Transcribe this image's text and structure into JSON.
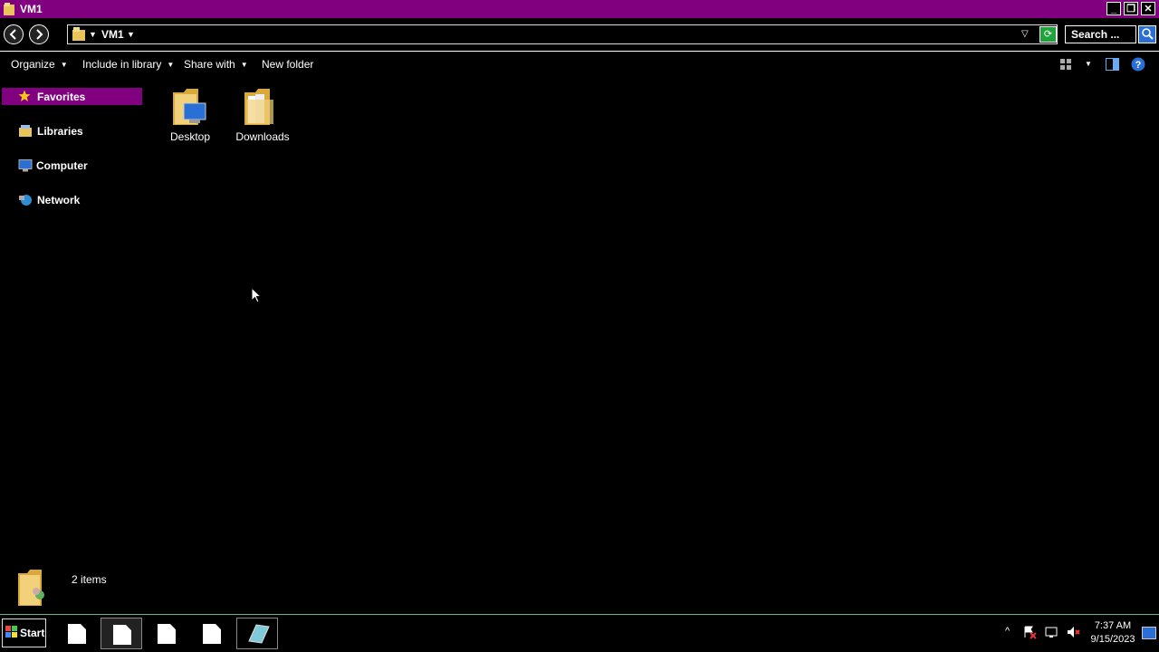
{
  "window": {
    "title": "VM1",
    "controls": {
      "minimize": "_",
      "restore": "❐",
      "close": "✕"
    }
  },
  "address": {
    "back_icon": "back-arrow-icon",
    "forward_icon": "forward-arrow-icon",
    "path_segment": "VM1",
    "search_placeholder": "Search ..."
  },
  "toolbar": {
    "organize": "Organize",
    "include_in_library": "Include in library",
    "share_with": "Share with",
    "new_folder": "New folder"
  },
  "nav_pane": {
    "items": [
      {
        "label": "Favorites",
        "icon": "star-icon",
        "selected": true
      },
      {
        "label": "Libraries",
        "icon": "library-icon"
      },
      {
        "label": "Computer",
        "icon": "computer-icon"
      },
      {
        "label": "Network",
        "icon": "network-icon"
      }
    ]
  },
  "content": {
    "items": [
      {
        "label": "Desktop",
        "icon": "desktop-folder-icon"
      },
      {
        "label": "Downloads",
        "icon": "downloads-folder-icon"
      }
    ]
  },
  "status": {
    "item_count": "2 items"
  },
  "taskbar": {
    "start_label": "Start",
    "clock_time": "7:37 AM",
    "clock_date": "9/15/2023"
  },
  "colors": {
    "title_bar": "#800080",
    "selection": "#800080",
    "background": "#000000",
    "text": "#ffffff"
  }
}
